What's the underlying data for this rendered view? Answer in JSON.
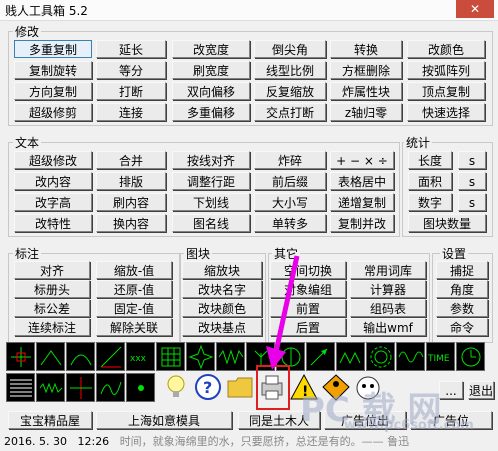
{
  "window": {
    "title": "贱人工具箱 5.2",
    "close_label": "✕"
  },
  "sections": {
    "modify": "修改",
    "text": "文本",
    "stats": "统计",
    "dimension": "标注",
    "block": "图块",
    "other": "其它",
    "settings": "设置"
  },
  "modify_rows": [
    [
      "多重复制",
      "延长",
      "改宽度",
      "倒尖角",
      "转换",
      "改颜色"
    ],
    [
      "复制旋转",
      "等分",
      "刷宽度",
      "线型比例",
      "方框删除",
      "按弧阵列"
    ],
    [
      "方向复制",
      "打断",
      "双向偏移",
      "反复缩放",
      "炸属性块",
      "顶点复制"
    ],
    [
      "超级修剪",
      "连接",
      "多重偏移",
      "交点打断",
      "z轴归零",
      "快速选择"
    ]
  ],
  "text_rows": [
    [
      "超级修改",
      "合并",
      "按线对齐",
      "炸碎",
      "+ − × ÷"
    ],
    [
      "改内容",
      "排版",
      "调整行距",
      "前后缀",
      "表格居中"
    ],
    [
      "改字高",
      "刷内容",
      "下划线",
      "大小写",
      "递增复制"
    ],
    [
      "改特性",
      "换内容",
      "图名线",
      "单转多",
      "复制并改"
    ]
  ],
  "stats_rows": [
    [
      "长度",
      "s"
    ],
    [
      "面积",
      "s"
    ],
    [
      "数字",
      "s"
    ],
    [
      "图块数量"
    ]
  ],
  "dim_rows": [
    [
      "对齐",
      "缩放-值"
    ],
    [
      "标册头",
      "还原-值"
    ],
    [
      "标公差",
      "固定-值"
    ],
    [
      "连续标注",
      "解除关联"
    ]
  ],
  "block_rows": [
    "缩放块",
    "改块名字",
    "改块颜色",
    "改块基点"
  ],
  "other_rows": [
    [
      "空间切换",
      "常用词库"
    ],
    [
      "对象编组",
      "计算器"
    ],
    [
      "前置",
      "组码表"
    ],
    [
      "后置",
      "输出wmf"
    ]
  ],
  "settings_rows": [
    "捕捉",
    "角度",
    "参数",
    "命令"
  ],
  "toolbar1_icons": [
    "crosshair-icon",
    "angle-icon",
    "curve-icon",
    "line-icon",
    "xxx-icon",
    "grid-icon",
    "star-icon",
    "wave-icon",
    "leaf-icon",
    "compass-icon",
    "arrow-icon",
    "zigzag-icon",
    "gear-icon",
    "sine-icon",
    "time-icon",
    "clock-icon"
  ],
  "toolbar1_time_label": "TIME",
  "toolbar2_icons": [
    "hatch-icon",
    "spring-icon",
    "cross-icon",
    "squiggle-icon",
    "dot-icon"
  ],
  "toolbar2_extra": [
    "bulb-icon",
    "help-icon",
    "folder-icon",
    "printer-icon",
    "warning-icon",
    "worker-icon",
    "mascot-icon"
  ],
  "right_buttons": {
    "b1": "...",
    "exit": "退出"
  },
  "bottom_links": [
    "宝宝精品屋",
    "上海如意模具",
    "同是土木人",
    "广告位出",
    "广告位"
  ],
  "status": {
    "date": "2016. 5. 30",
    "time": "12:26",
    "message": "时间，就象海绵里的水，只要愿挤，总还是有的。—— 鲁迅"
  },
  "watermark": {
    "line1": "PC 载 网",
    "line2": "www.pc6soft.com"
  }
}
